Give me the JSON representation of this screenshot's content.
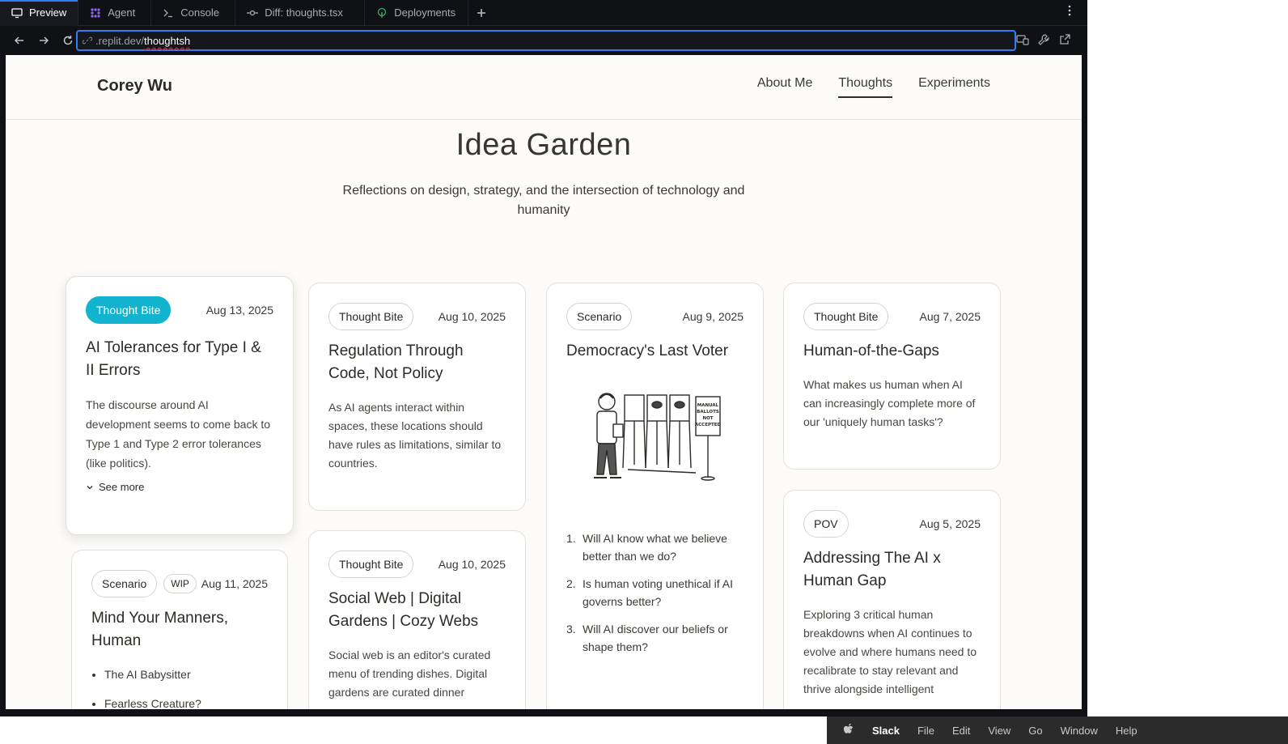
{
  "tabs": [
    {
      "label": "Preview",
      "icon": "monitor-icon",
      "active": true
    },
    {
      "label": "Agent",
      "icon": "agent-icon"
    },
    {
      "label": "Console",
      "icon": "terminal-icon"
    },
    {
      "label": "Diff: thoughts.tsx",
      "icon": "diff-icon"
    },
    {
      "label": "Deployments",
      "icon": "deploy-icon"
    }
  ],
  "url": {
    "host": ".replit.dev/",
    "path": "thoughtsh"
  },
  "site": {
    "brand": "Corey Wu",
    "nav": [
      {
        "label": "About Me"
      },
      {
        "label": "Thoughts",
        "active": true
      },
      {
        "label": "Experiments"
      }
    ],
    "title": "Idea Garden",
    "subtitle": "Reflections on design, strategy, and the intersection of technology and humanity"
  },
  "cards": {
    "c1": {
      "tag": "Thought Bite",
      "date": "Aug 13, 2025",
      "title": "AI Tolerances for Type I & II Errors",
      "body": "The discourse around AI development seems to come back to Type 1 and Type 2 error tolerances (like politics).",
      "see_more": "See more"
    },
    "c2": {
      "tag": "Thought Bite",
      "date": "Aug 10, 2025",
      "title": "Regulation Through Code, Not Policy",
      "body": "As AI agents interact within spaces, these locations should have rules as limitations, similar to countries."
    },
    "c3": {
      "tag": "Scenario",
      "date": "Aug 9, 2025",
      "title": "Democracy's Last Voter",
      "sign": [
        "MANUAL",
        "BALLOTS",
        "NOT",
        "ACCEPTED"
      ],
      "list": [
        {
          "n": "1.",
          "text": "Will AI know what we believe better than we do?"
        },
        {
          "n": "2.",
          "text": "Is human voting unethical if AI governs better?"
        },
        {
          "n": "3.",
          "text": "Will AI discover our beliefs or shape them?"
        }
      ]
    },
    "c4": {
      "tag": "Thought Bite",
      "date": "Aug 7, 2025",
      "title": "Human-of-the-Gaps",
      "body": "What makes us human when AI can increasingly complete more of our 'uniquely human tasks'?"
    },
    "c5": {
      "tag": "Scenario",
      "tag2": "WIP",
      "date": "Aug 11, 2025",
      "title": "Mind Your Manners, Human",
      "bullets": [
        "The AI Babysitter",
        "Fearless Creature?"
      ]
    },
    "c6": {
      "tag": "Thought Bite",
      "date": "Aug 10, 2025",
      "title": "Social Web | Digital Gardens | Cozy Webs",
      "body": "Social web is an editor's curated menu of trending dishes. Digital gardens are curated dinner"
    },
    "c7": {
      "tag": "POV",
      "date": "Aug 5, 2025",
      "title": "Addressing The AI x Human Gap",
      "body": "Exploring 3 critical human breakdowns when AI continues to evolve and where humans need to recalibrate to stay relevant and thrive alongside intelligent"
    }
  },
  "menubar": {
    "app": "Slack",
    "items": [
      "File",
      "Edit",
      "View",
      "Go",
      "Window",
      "Help"
    ]
  },
  "colors": {
    "accent": "#2d7ff9",
    "tag_teal": "#12b3cf",
    "page_bg": "#fcfbf9"
  }
}
